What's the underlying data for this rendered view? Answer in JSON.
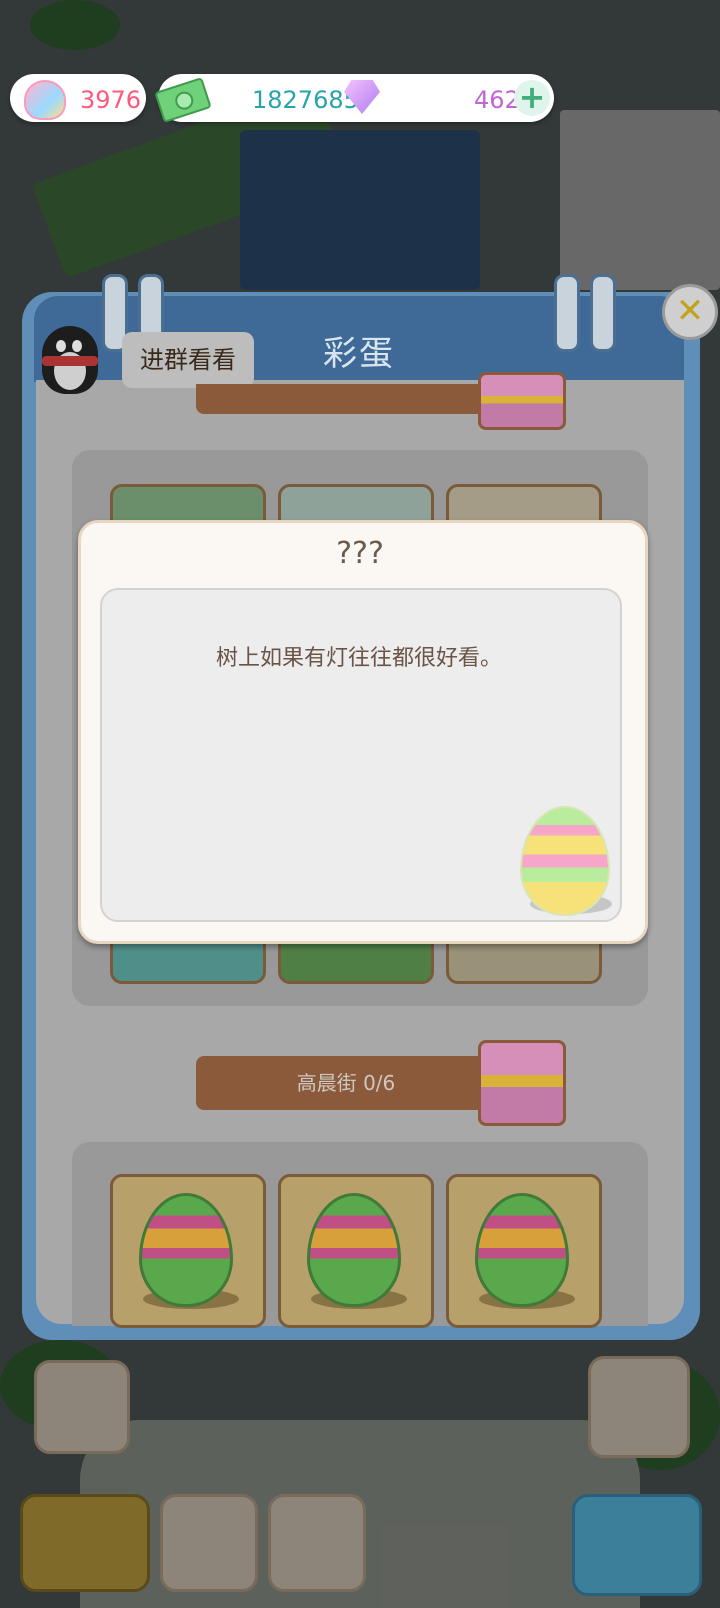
{
  "currency": {
    "shells": "3976",
    "cash": "1827685",
    "gems": "462",
    "add_symbol": "+"
  },
  "panel": {
    "title": "彩蛋",
    "close_symbol": "✕",
    "join_group_label": "进群看看",
    "sections": [
      {
        "label": "",
        "progress": ""
      },
      {
        "label": "高晨街 0/6"
      }
    ]
  },
  "dialog": {
    "title": "???",
    "message": "树上如果有灯往往都很好看。"
  },
  "colors": {
    "panel_header": "#3f6a98",
    "section_bar": "#8a5a3a",
    "dialog_bg": "#fbf7f2",
    "shells_text": "#ff5a7d",
    "cash_text": "#2aa3a8",
    "gems_text": "#c264d6"
  },
  "icons": {
    "shells": "shell-icon",
    "cash": "cash-icon",
    "gems": "gem-icon",
    "add": "plus-icon",
    "close": "close-icon",
    "mascot": "penguin-icon",
    "gift": "gift-icon",
    "egg": "easter-egg-icon"
  }
}
